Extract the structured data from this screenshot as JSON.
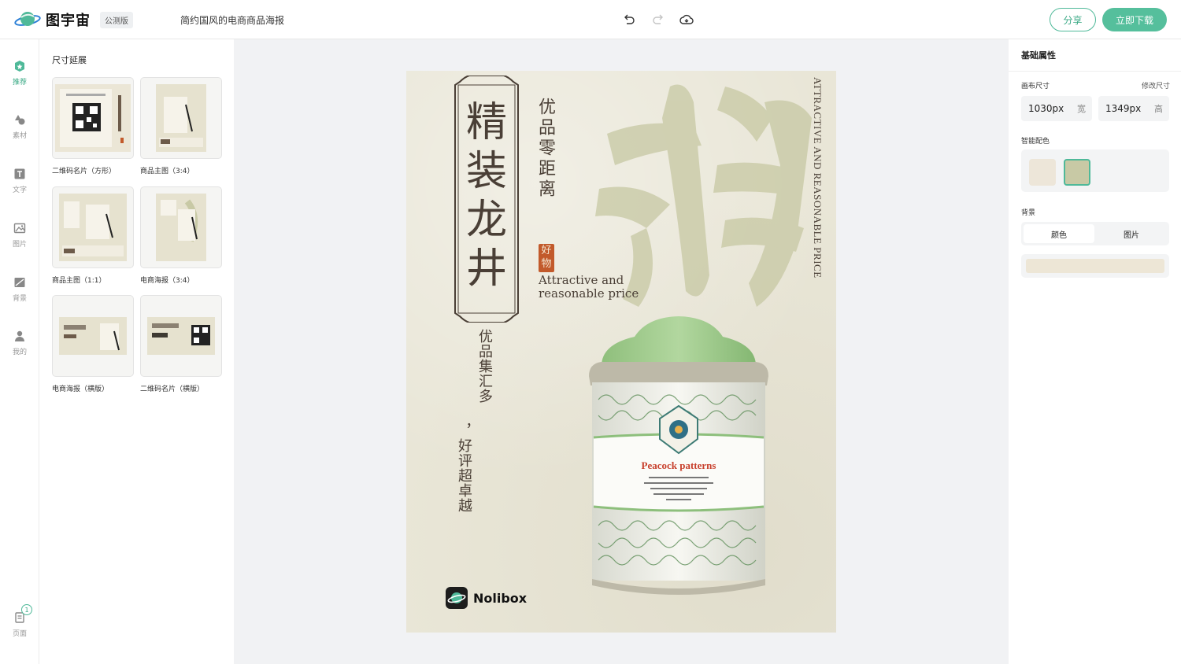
{
  "app": {
    "name": "图宇宙",
    "badge": "公测版",
    "doc_title": "简约国风的电商商品海报",
    "share_label": "分享",
    "download_label": "立即下载"
  },
  "rail": {
    "items": [
      {
        "label": "推荐",
        "icon": "recommend-icon"
      },
      {
        "label": "素材",
        "icon": "shapes-icon"
      },
      {
        "label": "文字",
        "icon": "text-icon"
      },
      {
        "label": "图片",
        "icon": "image-icon"
      },
      {
        "label": "背景",
        "icon": "background-icon"
      },
      {
        "label": "我的",
        "icon": "user-icon"
      }
    ],
    "pages_label": "页面",
    "pages_count": "1"
  },
  "panel": {
    "title": "尺寸延展",
    "templates": [
      {
        "label": "二维码名片（方形）"
      },
      {
        "label": "商品主图（3:4）"
      },
      {
        "label": "商品主图（1:1）"
      },
      {
        "label": "电商海报（3:4）"
      },
      {
        "label": "电商海报（横版）"
      },
      {
        "label": "二维码名片（横版）"
      }
    ]
  },
  "poster": {
    "title_chars": [
      "精",
      "装",
      "龙",
      "井"
    ],
    "sub_vertical": "优品零距离",
    "seal_text": "好物",
    "attractive": "Attractive and reasonable price",
    "vertical_en": "ATTRACTIVE AND REASONABLE PRICE",
    "line1": "优品集汇多",
    "line2": "，好评超卓越",
    "can_title": "Peacock patterns",
    "can_body": "Lorem ipsum dolor sit amet, consectetur adipiscing elit. Quisque ac elit nec viverra dignissim scelerisque a in neque.",
    "brand": "Nolibox"
  },
  "props": {
    "title": "基础属性",
    "canvas_size_label": "画布尺寸",
    "edit_size_label": "修改尺寸",
    "width_value": "1030px",
    "width_unit": "宽",
    "height_value": "1349px",
    "height_unit": "高",
    "smart_color_label": "智能配色",
    "swatches": [
      "#ede6d9",
      "#c8c9a5"
    ],
    "background_label": "背景",
    "bg_tab_color": "颜色",
    "bg_tab_image": "图片",
    "bg_color": "#ede6d6"
  }
}
